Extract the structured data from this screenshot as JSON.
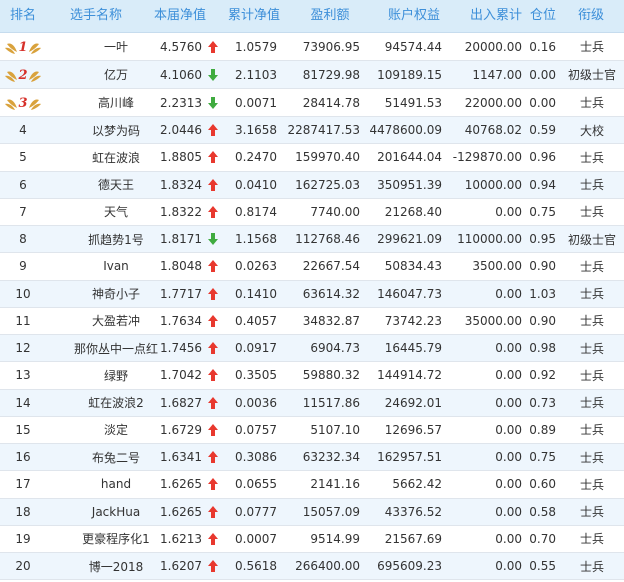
{
  "header": {
    "rank": "排名",
    "name": "选手名称",
    "nav": "本届净值",
    "cum_nav": "累计净值",
    "profit": "盈利额",
    "equity": "账户权益",
    "flow": "出入累计",
    "position": "仓位",
    "title": "衔级"
  },
  "colors": {
    "header_bg": "#d9ecf9",
    "header_text": "#3d8fd9",
    "up": "#e8382e",
    "down": "#3fab3f",
    "medal_gold": "#d9a23c",
    "medal_number": "#d6302a"
  },
  "rows": [
    {
      "rank": "1",
      "medal": true,
      "name": "一叶",
      "nav": "4.5760",
      "trend": "up",
      "cum_nav": "1.0579",
      "profit": "73906.95",
      "equity": "94574.44",
      "flow": "20000.00",
      "position": "0.16",
      "title": "士兵"
    },
    {
      "rank": "2",
      "medal": true,
      "name": "亿万",
      "nav": "4.1060",
      "trend": "down",
      "cum_nav": "2.1103",
      "profit": "81729.98",
      "equity": "109189.15",
      "flow": "1147.00",
      "position": "0.00",
      "title": "初级士官"
    },
    {
      "rank": "3",
      "medal": true,
      "name": "高川峰",
      "nav": "2.2313",
      "trend": "down",
      "cum_nav": "0.0071",
      "profit": "28414.78",
      "equity": "51491.53",
      "flow": "22000.00",
      "position": "0.00",
      "title": "士兵"
    },
    {
      "rank": "4",
      "medal": false,
      "name": "以梦为码",
      "nav": "2.0446",
      "trend": "up",
      "cum_nav": "3.1658",
      "profit": "2287417.53",
      "equity": "4478600.09",
      "flow": "40768.02",
      "position": "0.59",
      "title": "大校"
    },
    {
      "rank": "5",
      "medal": false,
      "name": "虹在波浪",
      "nav": "1.8805",
      "trend": "up",
      "cum_nav": "0.2470",
      "profit": "159970.40",
      "equity": "201644.04",
      "flow": "-129870.00",
      "position": "0.96",
      "title": "士兵"
    },
    {
      "rank": "6",
      "medal": false,
      "name": "德天王",
      "nav": "1.8324",
      "trend": "up",
      "cum_nav": "0.0410",
      "profit": "162725.03",
      "equity": "350951.39",
      "flow": "10000.00",
      "position": "0.94",
      "title": "士兵"
    },
    {
      "rank": "7",
      "medal": false,
      "name": "天气",
      "nav": "1.8322",
      "trend": "up",
      "cum_nav": "0.8174",
      "profit": "7740.00",
      "equity": "21268.40",
      "flow": "0.00",
      "position": "0.75",
      "title": "士兵"
    },
    {
      "rank": "8",
      "medal": false,
      "name": "抓趋势1号",
      "nav": "1.8171",
      "trend": "down",
      "cum_nav": "1.1568",
      "profit": "112768.46",
      "equity": "299621.09",
      "flow": "110000.00",
      "position": "0.95",
      "title": "初级士官"
    },
    {
      "rank": "9",
      "medal": false,
      "name": "Ivan",
      "nav": "1.8048",
      "trend": "up",
      "cum_nav": "0.0263",
      "profit": "22667.54",
      "equity": "50834.43",
      "flow": "3500.00",
      "position": "0.90",
      "title": "士兵"
    },
    {
      "rank": "10",
      "medal": false,
      "name": "神奇小子",
      "nav": "1.7717",
      "trend": "up",
      "cum_nav": "0.1410",
      "profit": "63614.32",
      "equity": "146047.73",
      "flow": "0.00",
      "position": "1.03",
      "title": "士兵"
    },
    {
      "rank": "11",
      "medal": false,
      "name": "大盈若冲",
      "nav": "1.7634",
      "trend": "up",
      "cum_nav": "0.4057",
      "profit": "34832.87",
      "equity": "73742.23",
      "flow": "35000.00",
      "position": "0.90",
      "title": "士兵"
    },
    {
      "rank": "12",
      "medal": false,
      "name": "那你丛中一点红",
      "nav": "1.7456",
      "trend": "up",
      "cum_nav": "0.0917",
      "profit": "6904.73",
      "equity": "16445.79",
      "flow": "0.00",
      "position": "0.98",
      "title": "士兵"
    },
    {
      "rank": "13",
      "medal": false,
      "name": "绿野",
      "nav": "1.7042",
      "trend": "up",
      "cum_nav": "0.3505",
      "profit": "59880.32",
      "equity": "144914.72",
      "flow": "0.00",
      "position": "0.92",
      "title": "士兵"
    },
    {
      "rank": "14",
      "medal": false,
      "name": "虹在波浪2",
      "nav": "1.6827",
      "trend": "up",
      "cum_nav": "0.0036",
      "profit": "11517.86",
      "equity": "24692.01",
      "flow": "0.00",
      "position": "0.73",
      "title": "士兵"
    },
    {
      "rank": "15",
      "medal": false,
      "name": "淡定",
      "nav": "1.6729",
      "trend": "up",
      "cum_nav": "0.0757",
      "profit": "5107.10",
      "equity": "12696.57",
      "flow": "0.00",
      "position": "0.89",
      "title": "士兵"
    },
    {
      "rank": "16",
      "medal": false,
      "name": "布兔二号",
      "nav": "1.6341",
      "trend": "up",
      "cum_nav": "0.3086",
      "profit": "63232.34",
      "equity": "162957.51",
      "flow": "0.00",
      "position": "0.75",
      "title": "士兵"
    },
    {
      "rank": "17",
      "medal": false,
      "name": "hand",
      "nav": "1.6265",
      "trend": "up",
      "cum_nav": "0.0655",
      "profit": "2141.16",
      "equity": "5662.42",
      "flow": "0.00",
      "position": "0.60",
      "title": "士兵"
    },
    {
      "rank": "18",
      "medal": false,
      "name": "JackHua",
      "nav": "1.6265",
      "trend": "up",
      "cum_nav": "0.0777",
      "profit": "15057.09",
      "equity": "43376.52",
      "flow": "0.00",
      "position": "0.58",
      "title": "士兵"
    },
    {
      "rank": "19",
      "medal": false,
      "name": "更豪程序化1",
      "nav": "1.6213",
      "trend": "up",
      "cum_nav": "0.0007",
      "profit": "9514.99",
      "equity": "21567.69",
      "flow": "0.00",
      "position": "0.70",
      "title": "士兵"
    },
    {
      "rank": "20",
      "medal": false,
      "name": "博一2018",
      "nav": "1.6207",
      "trend": "up",
      "cum_nav": "0.5618",
      "profit": "266400.00",
      "equity": "695609.23",
      "flow": "0.00",
      "position": "0.55",
      "title": "士兵"
    }
  ]
}
